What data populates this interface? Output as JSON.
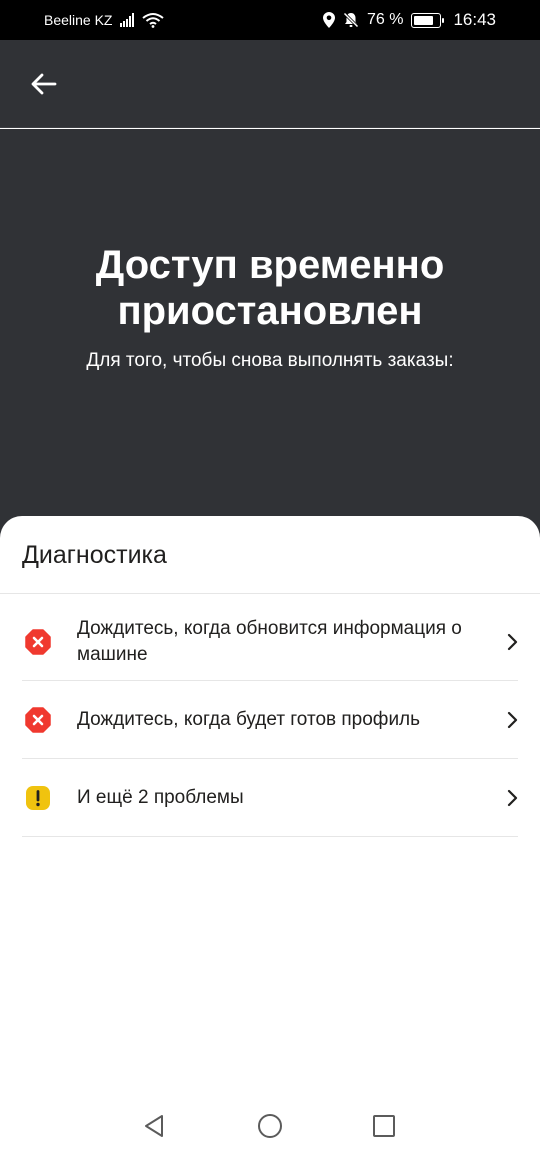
{
  "status_bar": {
    "carrier": "Beeline KZ",
    "battery": "76 %",
    "battery_level": 0.76,
    "time": "16:43",
    "icons": [
      "signal-icon",
      "wifi-icon",
      "location-icon",
      "mute-icon",
      "battery-icon"
    ]
  },
  "header": {
    "back_icon": "arrow-left-icon"
  },
  "hero": {
    "title": "Доступ временно приостановлен",
    "subtitle": "Для того, чтобы снова выполнять заказы:",
    "background": "#303236"
  },
  "diagnostics": {
    "title": "Диагностика",
    "items": [
      {
        "text": "Дождитесь, когда обновится информация о машине",
        "icon": "error-icon",
        "color": "#f0392f"
      },
      {
        "text": "Дождитесь, когда будет готов профиль",
        "icon": "error-icon",
        "color": "#f0392f"
      },
      {
        "text": "И ещё 2 проблемы",
        "icon": "warning-icon",
        "color": "#f0c30f"
      }
    ]
  },
  "nav_bar": {
    "icons": [
      "back-triangle-icon",
      "home-circle-icon",
      "recents-square-icon"
    ]
  }
}
